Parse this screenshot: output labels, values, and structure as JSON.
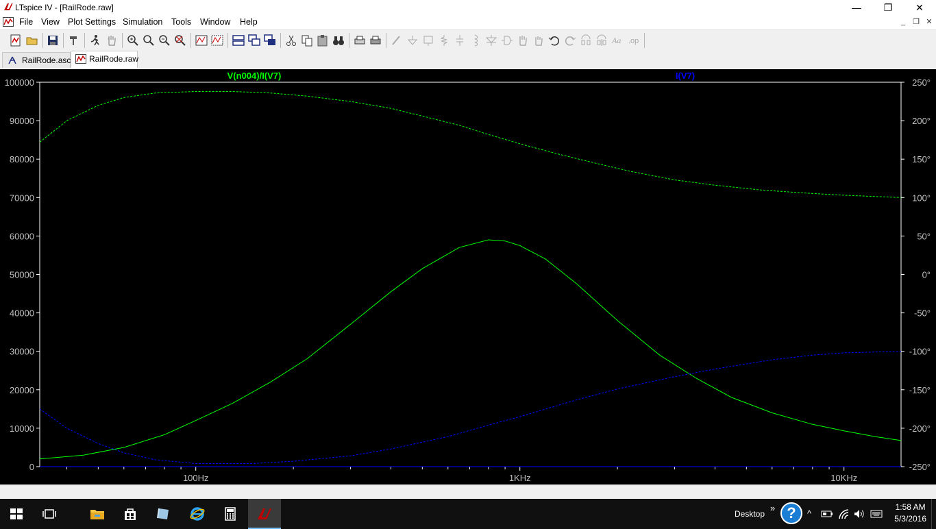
{
  "window": {
    "title": "LTspice IV - [RailRode.raw]",
    "minimize_symbol": "—",
    "restore_symbol": "❐",
    "close_symbol": "✕",
    "mdi_minimize_symbol": "_",
    "mdi_restore_symbol": "❐",
    "mdi_close_symbol": "✕"
  },
  "menu": {
    "items": [
      {
        "label": "File"
      },
      {
        "label": "View"
      },
      {
        "label": "Plot Settings"
      },
      {
        "label": "Simulation"
      },
      {
        "label": "Tools"
      },
      {
        "label": "Window"
      },
      {
        "label": "Help"
      }
    ]
  },
  "tabs": [
    {
      "label": "RailRode.asc",
      "icon": "schematic-icon",
      "active": false
    },
    {
      "label": "RailRode.raw",
      "icon": "waveform-icon",
      "active": true
    }
  ],
  "colors": {
    "plot_background": "#000000",
    "frame": "#ffffff",
    "trace_1": "#00ff00",
    "trace_2": "#0000ff",
    "axis_text": "#c0c0c0"
  },
  "chart_data": {
    "type": "line",
    "x_scale": "log",
    "xlim": [
      33,
      15000
    ],
    "left_ylim": [
      0,
      100000
    ],
    "right_ylim": [
      -250,
      250
    ],
    "x_ticks": [
      {
        "value": 100,
        "label": "100Hz"
      },
      {
        "value": 1000,
        "label": "1KHz"
      },
      {
        "value": 10000,
        "label": "10KHz"
      }
    ],
    "left_ticks": [
      "100000",
      "90000",
      "80000",
      "70000",
      "60000",
      "50000",
      "40000",
      "30000",
      "20000",
      "10000",
      "0"
    ],
    "left_tick_values": [
      100000,
      90000,
      80000,
      70000,
      60000,
      50000,
      40000,
      30000,
      20000,
      10000,
      0
    ],
    "right_ticks": [
      "250°",
      "200°",
      "150°",
      "100°",
      "50°",
      "0°",
      "-50°",
      "-100°",
      "-150°",
      "-200°",
      "-250°"
    ],
    "right_tick_values": [
      250,
      200,
      150,
      100,
      50,
      0,
      -50,
      -100,
      -150,
      -200,
      -250
    ],
    "grid": false,
    "series": [
      {
        "name": "V(n004)/I(V7)",
        "axis": "left",
        "style": "solid",
        "color": "#00ff00",
        "x": [
          33,
          45,
          60,
          80,
          100,
          130,
          170,
          220,
          300,
          400,
          500,
          650,
          800,
          900,
          1000,
          1200,
          1500,
          2000,
          2700,
          3500,
          4500,
          6000,
          8000,
          10000,
          12500,
          15000
        ],
        "y": [
          2000,
          3000,
          5000,
          8300,
          12000,
          16500,
          22000,
          28000,
          37000,
          45500,
          51500,
          57000,
          59000,
          58700,
          57500,
          54000,
          47500,
          38000,
          29000,
          23000,
          18000,
          14000,
          11000,
          9300,
          7800,
          6800
        ]
      },
      {
        "name": "V(n004)/I(V7)",
        "axis": "right",
        "style": "dashed",
        "color": "#00ff00",
        "x": [
          33,
          40,
          50,
          60,
          75,
          100,
          130,
          170,
          220,
          300,
          400,
          500,
          650,
          800,
          1000,
          1300,
          1700,
          2200,
          3000,
          4000,
          5500,
          7500,
          10000,
          15000
        ],
        "y": [
          172,
          200,
          220,
          230,
          236,
          238,
          238,
          236,
          232,
          225,
          216,
          206,
          194,
          182,
          170,
          157,
          145,
          134,
          123,
          116,
          110,
          106,
          103,
          100
        ]
      },
      {
        "name": "I(V7)",
        "axis": "right",
        "style": "dashed",
        "color": "#0000ff",
        "x": [
          33,
          40,
          50,
          60,
          75,
          100,
          150,
          200,
          300,
          400,
          600,
          800,
          1000,
          1500,
          2000,
          3000,
          4000,
          6000,
          8000,
          10000,
          15000
        ],
        "y": [
          -175,
          -200,
          -220,
          -232,
          -241,
          -246,
          -246,
          -243,
          -236,
          -227,
          -211,
          -196,
          -185,
          -163,
          -149,
          -133,
          -123,
          -111,
          -105,
          -102,
          -100
        ]
      },
      {
        "name": "I(V7)",
        "axis": "left",
        "style": "solid",
        "color": "#0000ff",
        "x": [
          33,
          15000
        ],
        "y": [
          0,
          0
        ]
      }
    ],
    "legend": [
      {
        "label": "V(n004)/I(V7)",
        "color": "#00ff00"
      },
      {
        "label": "I(V7)",
        "color": "#0000ff"
      }
    ]
  },
  "taskbar": {
    "desktop_label": "Desktop",
    "more_symbol": "»",
    "help_symbol": "?",
    "chevron_symbol": "^",
    "time": "1:58 AM",
    "date": "5/3/2016"
  }
}
